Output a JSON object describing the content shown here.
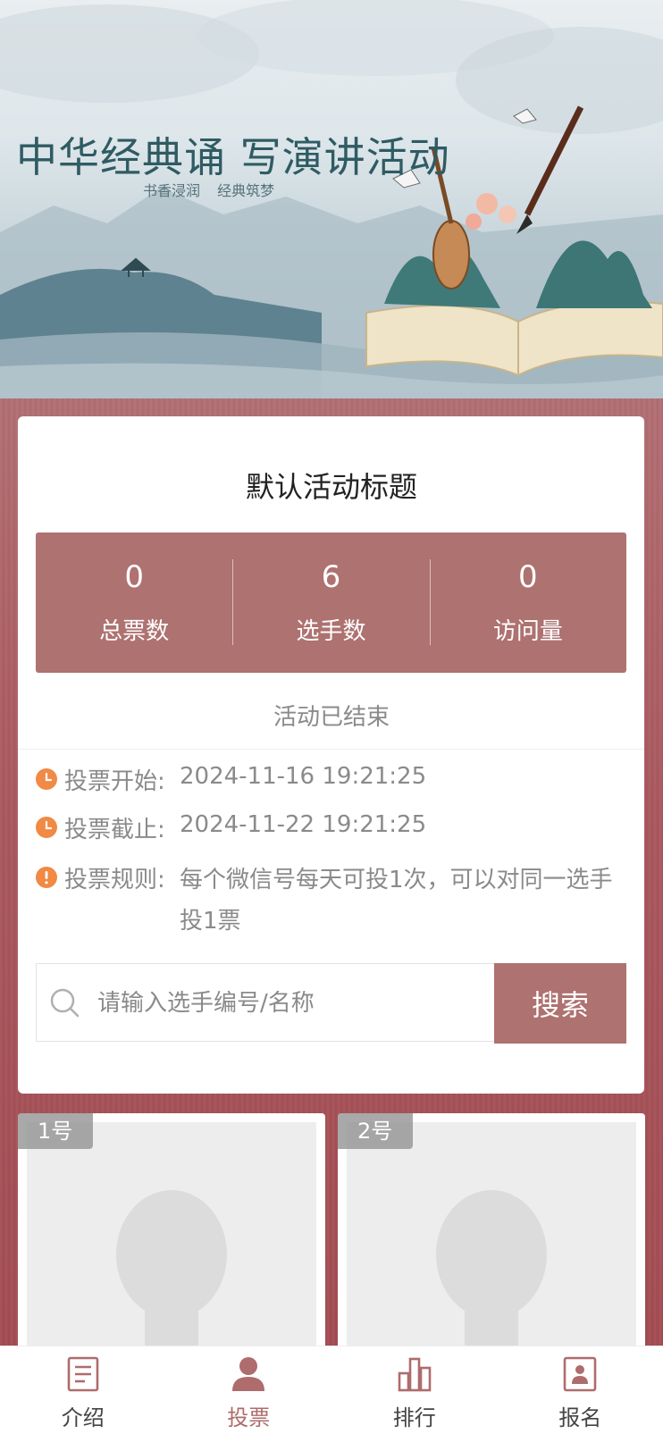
{
  "banner": {
    "title": "中华经典诵 写演讲活动",
    "subtitle": "书香浸润  经典筑梦"
  },
  "activity": {
    "title": "默认活动标题",
    "status": "活动已结束"
  },
  "stats": [
    {
      "value": "0",
      "label": "总票数"
    },
    {
      "value": "6",
      "label": "选手数"
    },
    {
      "value": "0",
      "label": "访问量"
    }
  ],
  "info": {
    "start_label": "投票开始:",
    "start_value": "2024-11-16 19:21:25",
    "end_label": "投票截止:",
    "end_value": "2024-11-22 19:21:25",
    "rules_label": "投票规则:",
    "rules_value": "每个微信号每天可投1次，可以对同一选手投1票"
  },
  "search": {
    "placeholder": "请输入选手编号/名称",
    "button_label": "搜索"
  },
  "contestants": [
    {
      "number": "1号"
    },
    {
      "number": "2号"
    }
  ],
  "nav": [
    {
      "label": "介绍",
      "icon": "document-icon",
      "active": false
    },
    {
      "label": "投票",
      "icon": "person-icon",
      "active": true
    },
    {
      "label": "排行",
      "icon": "bar-chart-icon",
      "active": false
    },
    {
      "label": "报名",
      "icon": "id-card-icon",
      "active": false
    }
  ],
  "colors": {
    "accent": "#ae7270",
    "active_nav": "#ae6c6c",
    "info_icon": "#f08a45"
  }
}
